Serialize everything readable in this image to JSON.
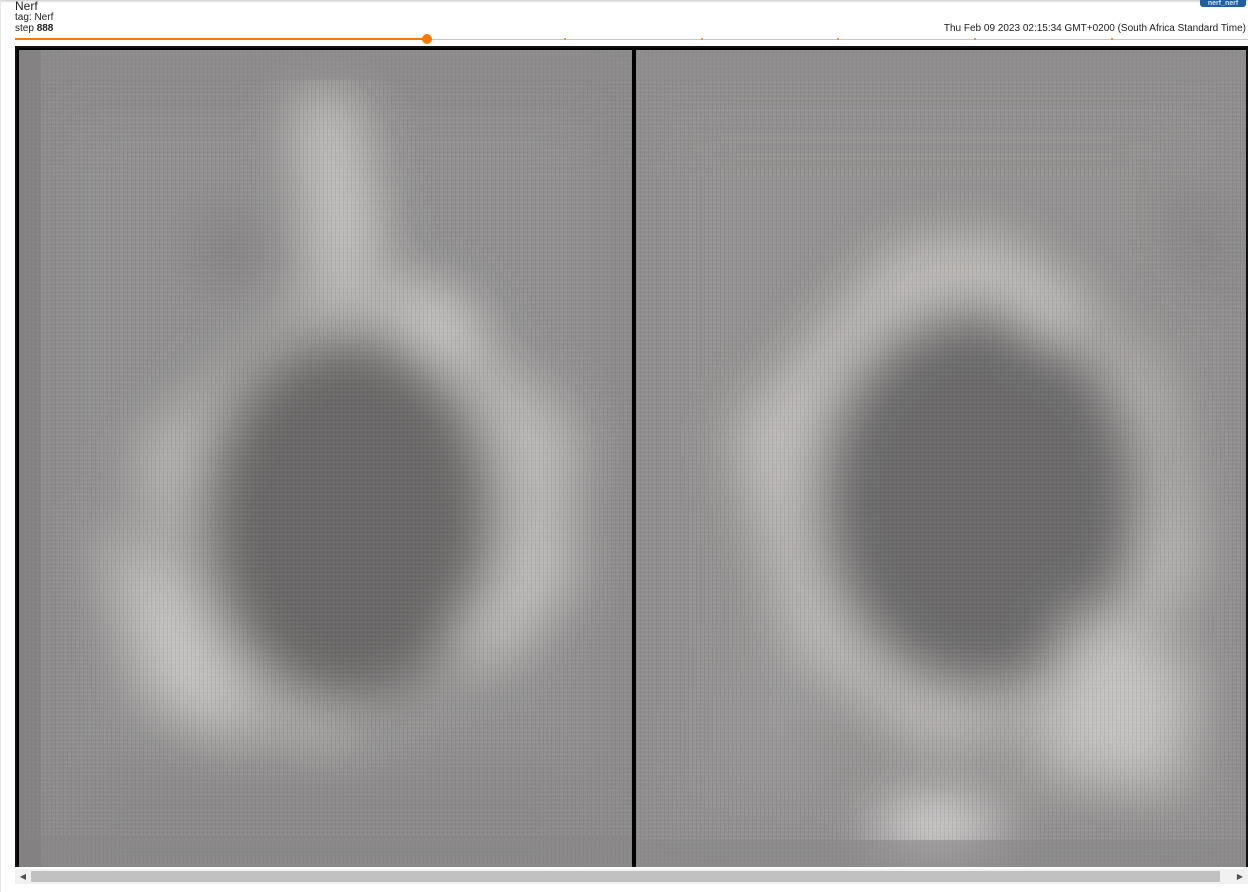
{
  "card": {
    "title": "Nerf",
    "tag_line": "tag: Nerf",
    "step_label": "step",
    "step_value": "888",
    "timestamp": "Thu Feb 09 2023 02:15:34 GMT+0200 (South Africa Standard Time)",
    "run_badge": "nerf_nerf"
  },
  "slider": {
    "position_fraction": 0.334,
    "tick_fractions": [
      0.445,
      0.556,
      0.667,
      0.778,
      0.889
    ],
    "accent_color": "#f57c00"
  },
  "image": {
    "panels": [
      "rendered-view-left",
      "rendered-view-right"
    ]
  },
  "scrollbar": {
    "left_arrow": "◀",
    "right_arrow": "▶"
  }
}
